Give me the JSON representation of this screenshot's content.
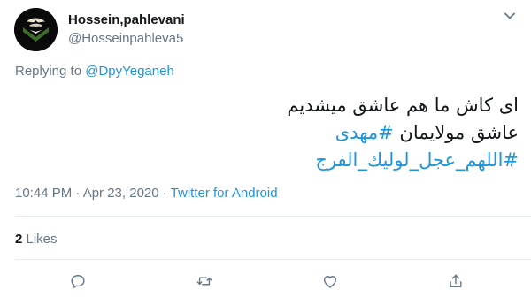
{
  "author": {
    "display_name": "Hossein,pahlevani",
    "handle": "@Hosseinpahleva5",
    "avatar_icon": "calligraphy-emblem-avatar"
  },
  "reply": {
    "prefix": "Replying to",
    "target": "@DpyYeganeh"
  },
  "tweet": {
    "line1": "ای کاش ما هم عاشق میشدیم",
    "line2_text": "عاشق مولایمان",
    "line2_hashtag": "#مهدی",
    "line3_hashtag": "#اللهم_عجل_لولیك_الفرج"
  },
  "meta": {
    "timestamp": "10:44 PM · Apr 23, 2020 · ",
    "source": "Twitter for Android"
  },
  "engagement": {
    "likes_count": "2",
    "likes_label": " Likes"
  },
  "actions": {
    "icons": [
      "reply-icon",
      "retweet-icon",
      "like-icon",
      "share-icon"
    ]
  },
  "colors": {
    "link": "#1b95e0",
    "secondary_text": "#657786",
    "primary_text": "#14171a",
    "divider": "#e6ecf0",
    "action_icon": "#657786"
  }
}
